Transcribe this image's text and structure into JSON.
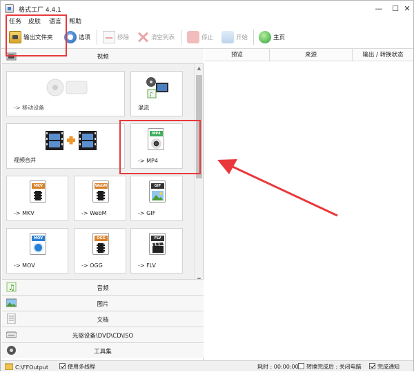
{
  "window": {
    "title": "格式工厂 4.4.1",
    "min_glyph": "—",
    "max_glyph": "☐",
    "close_glyph": "✕"
  },
  "menu": [
    "任务",
    "皮肤",
    "语言",
    "帮助"
  ],
  "toolbar": {
    "output_folder": "输出文件夹",
    "options": "选项",
    "remove": "移除",
    "clear_list": "清空列表",
    "stop": "停止",
    "start": "开始",
    "home": "主页"
  },
  "categories": {
    "video": "视频",
    "audio": "音频",
    "picture": "图片",
    "document": "文档",
    "optical": "光驱设备\\DVD\\CD\\ISO",
    "toolbox": "工具集"
  },
  "cards": [
    {
      "label": "-> 移动设备"
    },
    {
      "label": "混流"
    },
    {
      "label": "视频合并"
    },
    {
      "label": "-> MP4",
      "tag": "MP4"
    },
    {
      "label": "-> MKV",
      "tag": "MKV"
    },
    {
      "label": "-> WebM",
      "tag": "WebM"
    },
    {
      "label": "-> GIF",
      "tag": "GIF"
    },
    {
      "label": "-> MOV",
      "tag": "MOV"
    },
    {
      "label": "-> OGG",
      "tag": "OGG"
    },
    {
      "label": "-> FLV",
      "tag": "FLV"
    }
  ],
  "columns": [
    "预览",
    "来源",
    "输出 / 转换状态"
  ],
  "statusbar": {
    "output_path": "C:\\FFOutput",
    "multithread": "使用多线程",
    "elapsed": "耗时 : 00:00:00",
    "after_done": "转换完成后 : 关闭电脑",
    "notify": "完成通知"
  },
  "colors": {
    "annotation": "#e8383b",
    "mp4_tag": "#3fae5a",
    "mkv_tag": "#d9822b",
    "webm_tag": "#d9822b",
    "gif_tag": "#333333",
    "mov_tag": "#2a7fd4",
    "ogg_tag": "#d9822b",
    "flv_tag": "#333333"
  }
}
